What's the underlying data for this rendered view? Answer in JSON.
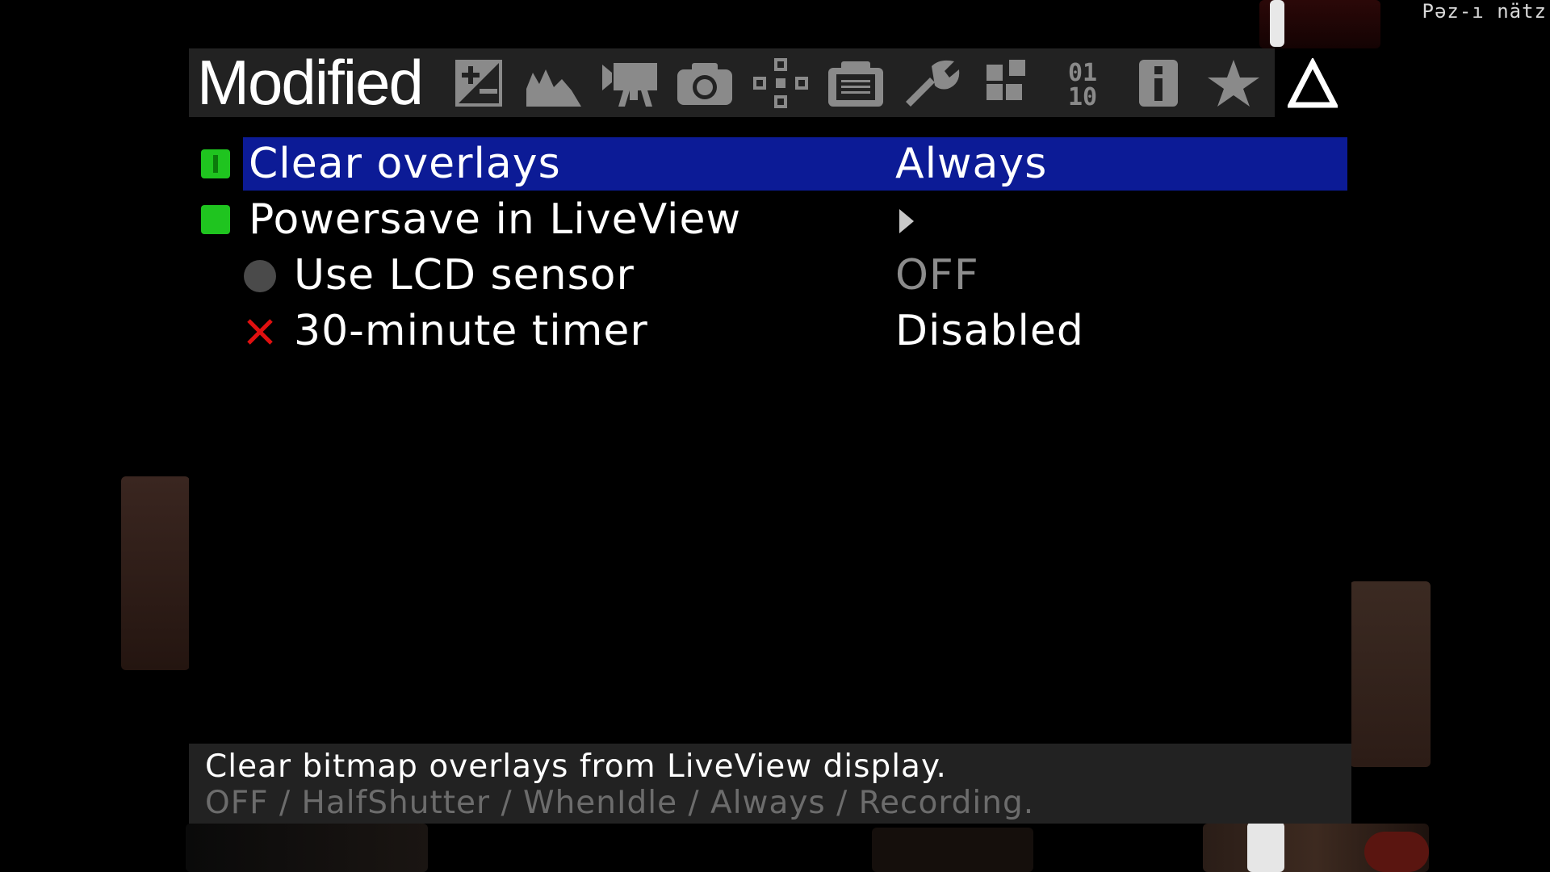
{
  "screen": {
    "corner_text": "Pəz-ı nätz"
  },
  "topbar": {
    "title": "Modified",
    "tabs": [
      {
        "icon": "exposure-icon",
        "active": false
      },
      {
        "icon": "histogram-icon",
        "active": false
      },
      {
        "icon": "movie-camera-icon",
        "active": false
      },
      {
        "icon": "camera-icon",
        "active": false
      },
      {
        "icon": "focus-icon",
        "active": false
      },
      {
        "icon": "display-icon",
        "active": false
      },
      {
        "icon": "wrench-icon",
        "active": false
      },
      {
        "icon": "modules-icon",
        "active": false
      },
      {
        "icon": "debug-icon",
        "active": false
      },
      {
        "icon": "info-icon",
        "active": false
      },
      {
        "icon": "star-icon",
        "active": false
      },
      {
        "icon": "modified-delta-icon",
        "active": true
      }
    ]
  },
  "menu": {
    "items": [
      {
        "label": "Clear overlays",
        "value": "Always",
        "selected": true,
        "indicator": "green-square-icon"
      },
      {
        "label": "Powersave in LiveView",
        "value": "",
        "selected": false,
        "indicator": "green-square-icon",
        "submenu": true
      },
      {
        "label": "Use LCD sensor",
        "value": "OFF",
        "selected": false,
        "indicator": "gray-circle-icon",
        "sub": true
      },
      {
        "label": "30-minute timer",
        "value": "Disabled",
        "selected": false,
        "indicator": "red-x-icon",
        "sub": true
      }
    ]
  },
  "help": {
    "line1": "Clear bitmap overlays from LiveView display.",
    "line2": "OFF / HalfShutter / WhenIdle / Always / Recording."
  },
  "colors": {
    "selection": "#0c1b96",
    "on_indicator": "#1fc41f",
    "off_indicator": "#4a4a4a",
    "disabled_x": "#e01010",
    "bar_bg": "#222222"
  }
}
